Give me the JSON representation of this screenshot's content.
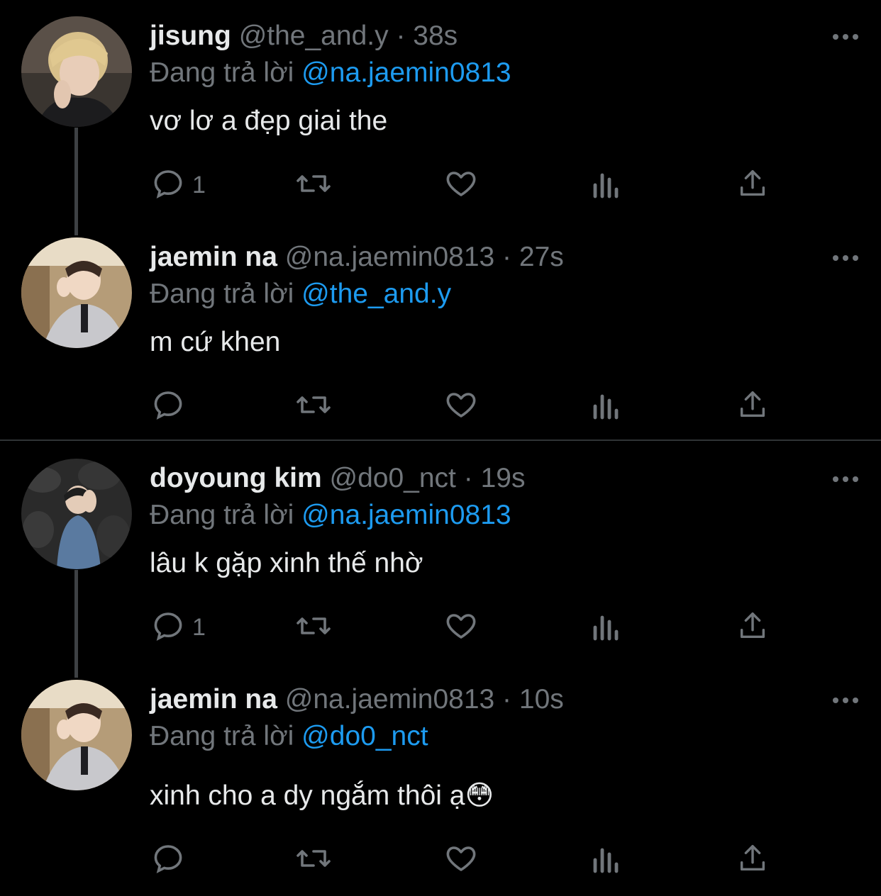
{
  "colors": {
    "background": "#000000",
    "text": "#e7e9ea",
    "muted": "#71767b",
    "mention": "#1d9bf0",
    "thread_line": "#3e4144"
  },
  "tweets": [
    {
      "name": "jisung",
      "handle": "@the_and.y",
      "time": "38s",
      "reply_prefix": "Đang trả lời",
      "reply_to": "@na.jaemin0813",
      "text": "vơ lơ a đẹp giai the",
      "reply_count": "1",
      "avatar": "blonde-portrait"
    },
    {
      "name": "jaemin na",
      "handle": "@na.jaemin0813",
      "time": "27s",
      "reply_prefix": "Đang trả lời",
      "reply_to": "@the_and.y",
      "text": "m cứ khen",
      "reply_count": "",
      "avatar": "cafe-portrait"
    },
    {
      "name": "doyoung kim",
      "handle": "@do0_nct",
      "time": "19s",
      "reply_prefix": "Đang trả lời",
      "reply_to": "@na.jaemin0813",
      "text": "lâu k gặp xinh thế nhờ",
      "reply_count": "1",
      "avatar": "stone-wall-portrait"
    },
    {
      "name": "jaemin na",
      "handle": "@na.jaemin0813",
      "time": "10s",
      "reply_prefix": "Đang trả lời",
      "reply_to": "@do0_nct",
      "text": "xinh cho a dy ngắm thôi ạ",
      "emoji": "😳",
      "reply_count": "",
      "avatar": "cafe-portrait"
    }
  ],
  "icons": {
    "reply": "reply-icon",
    "retweet": "retweet-icon",
    "like": "heart-icon",
    "views": "analytics-icon",
    "share": "share-icon",
    "more": "more-icon"
  }
}
